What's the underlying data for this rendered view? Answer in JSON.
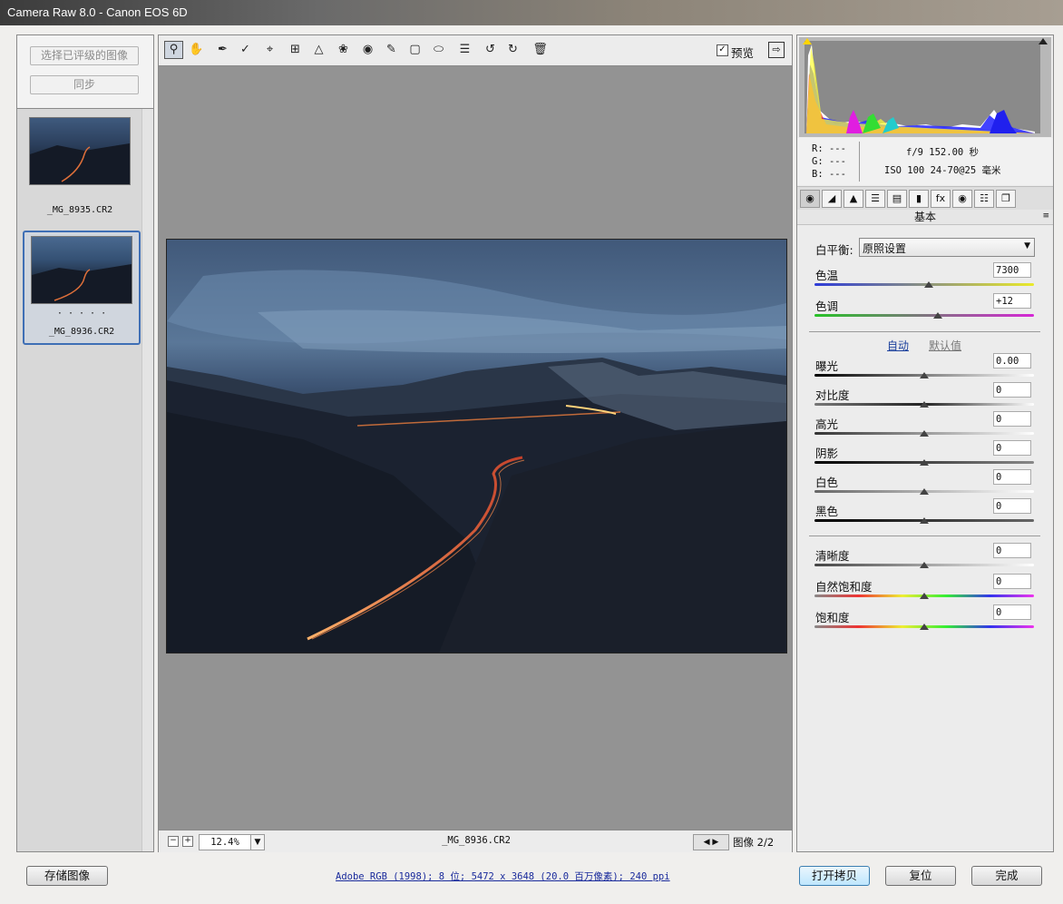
{
  "window": {
    "title": "Camera Raw 8.0 -  Canon EOS 6D"
  },
  "filmstrip": {
    "select_rated_label": "选择已评级的图像",
    "sync_label": "同步",
    "thumbnails": [
      {
        "filename": "_MG_8935.CR2",
        "rating": ""
      },
      {
        "filename": "_MG_8936.CR2",
        "rating": "· · · · ·"
      }
    ]
  },
  "toolbar": {
    "tools": [
      "zoom-tool",
      "hand-tool",
      "white-balance-tool",
      "color-sampler-tool",
      "target-adjust-tool",
      "crop-tool",
      "straighten-tool",
      "spot-removal-tool",
      "red-eye-tool",
      "adjustment-brush-tool",
      "graduated-filter-tool",
      "radial-filter-tool",
      "preferences",
      "rotate-left",
      "rotate-right",
      "delete"
    ],
    "preview_label": "预览",
    "preview_checked": true
  },
  "status": {
    "zoom_value": "12.4%",
    "filename": "_MG_8936.CR2",
    "image_counter": "图像 2/2"
  },
  "info": {
    "r": "R:  ---",
    "g": "G:  ---",
    "b": "B:  ---",
    "exposure_line": "f/9  152.00 秒",
    "iso_line": "ISO 100   24-70@25 毫米"
  },
  "basic": {
    "section_title": "基本",
    "white_balance_label": "白平衡:",
    "white_balance_value": "原照设置",
    "auto_link": "自动",
    "default_link": "默认值",
    "sliders": [
      {
        "label": "色温",
        "value": "7300",
        "pos": 0.52
      },
      {
        "label": "色调",
        "value": "+12",
        "pos": 0.56
      },
      {
        "label": "曝光",
        "value": "0.00",
        "pos": 0.5
      },
      {
        "label": "对比度",
        "value": "0",
        "pos": 0.5
      },
      {
        "label": "高光",
        "value": "0",
        "pos": 0.5
      },
      {
        "label": "阴影",
        "value": "0",
        "pos": 0.5
      },
      {
        "label": "白色",
        "value": "0",
        "pos": 0.5
      },
      {
        "label": "黑色",
        "value": "0",
        "pos": 0.5
      },
      {
        "label": "清晰度",
        "value": "0",
        "pos": 0.5
      },
      {
        "label": "自然饱和度",
        "value": "0",
        "pos": 0.5
      },
      {
        "label": "饱和度",
        "value": "0",
        "pos": 0.5
      }
    ]
  },
  "footer": {
    "save_label": "存储图像",
    "workflow_link": "Adobe RGB (1998); 8 位; 5472 x 3648 (20.0 百万像素); 240 ppi",
    "open_copy_label": "打开拷贝",
    "reset_label": "复位",
    "done_label": "完成"
  }
}
